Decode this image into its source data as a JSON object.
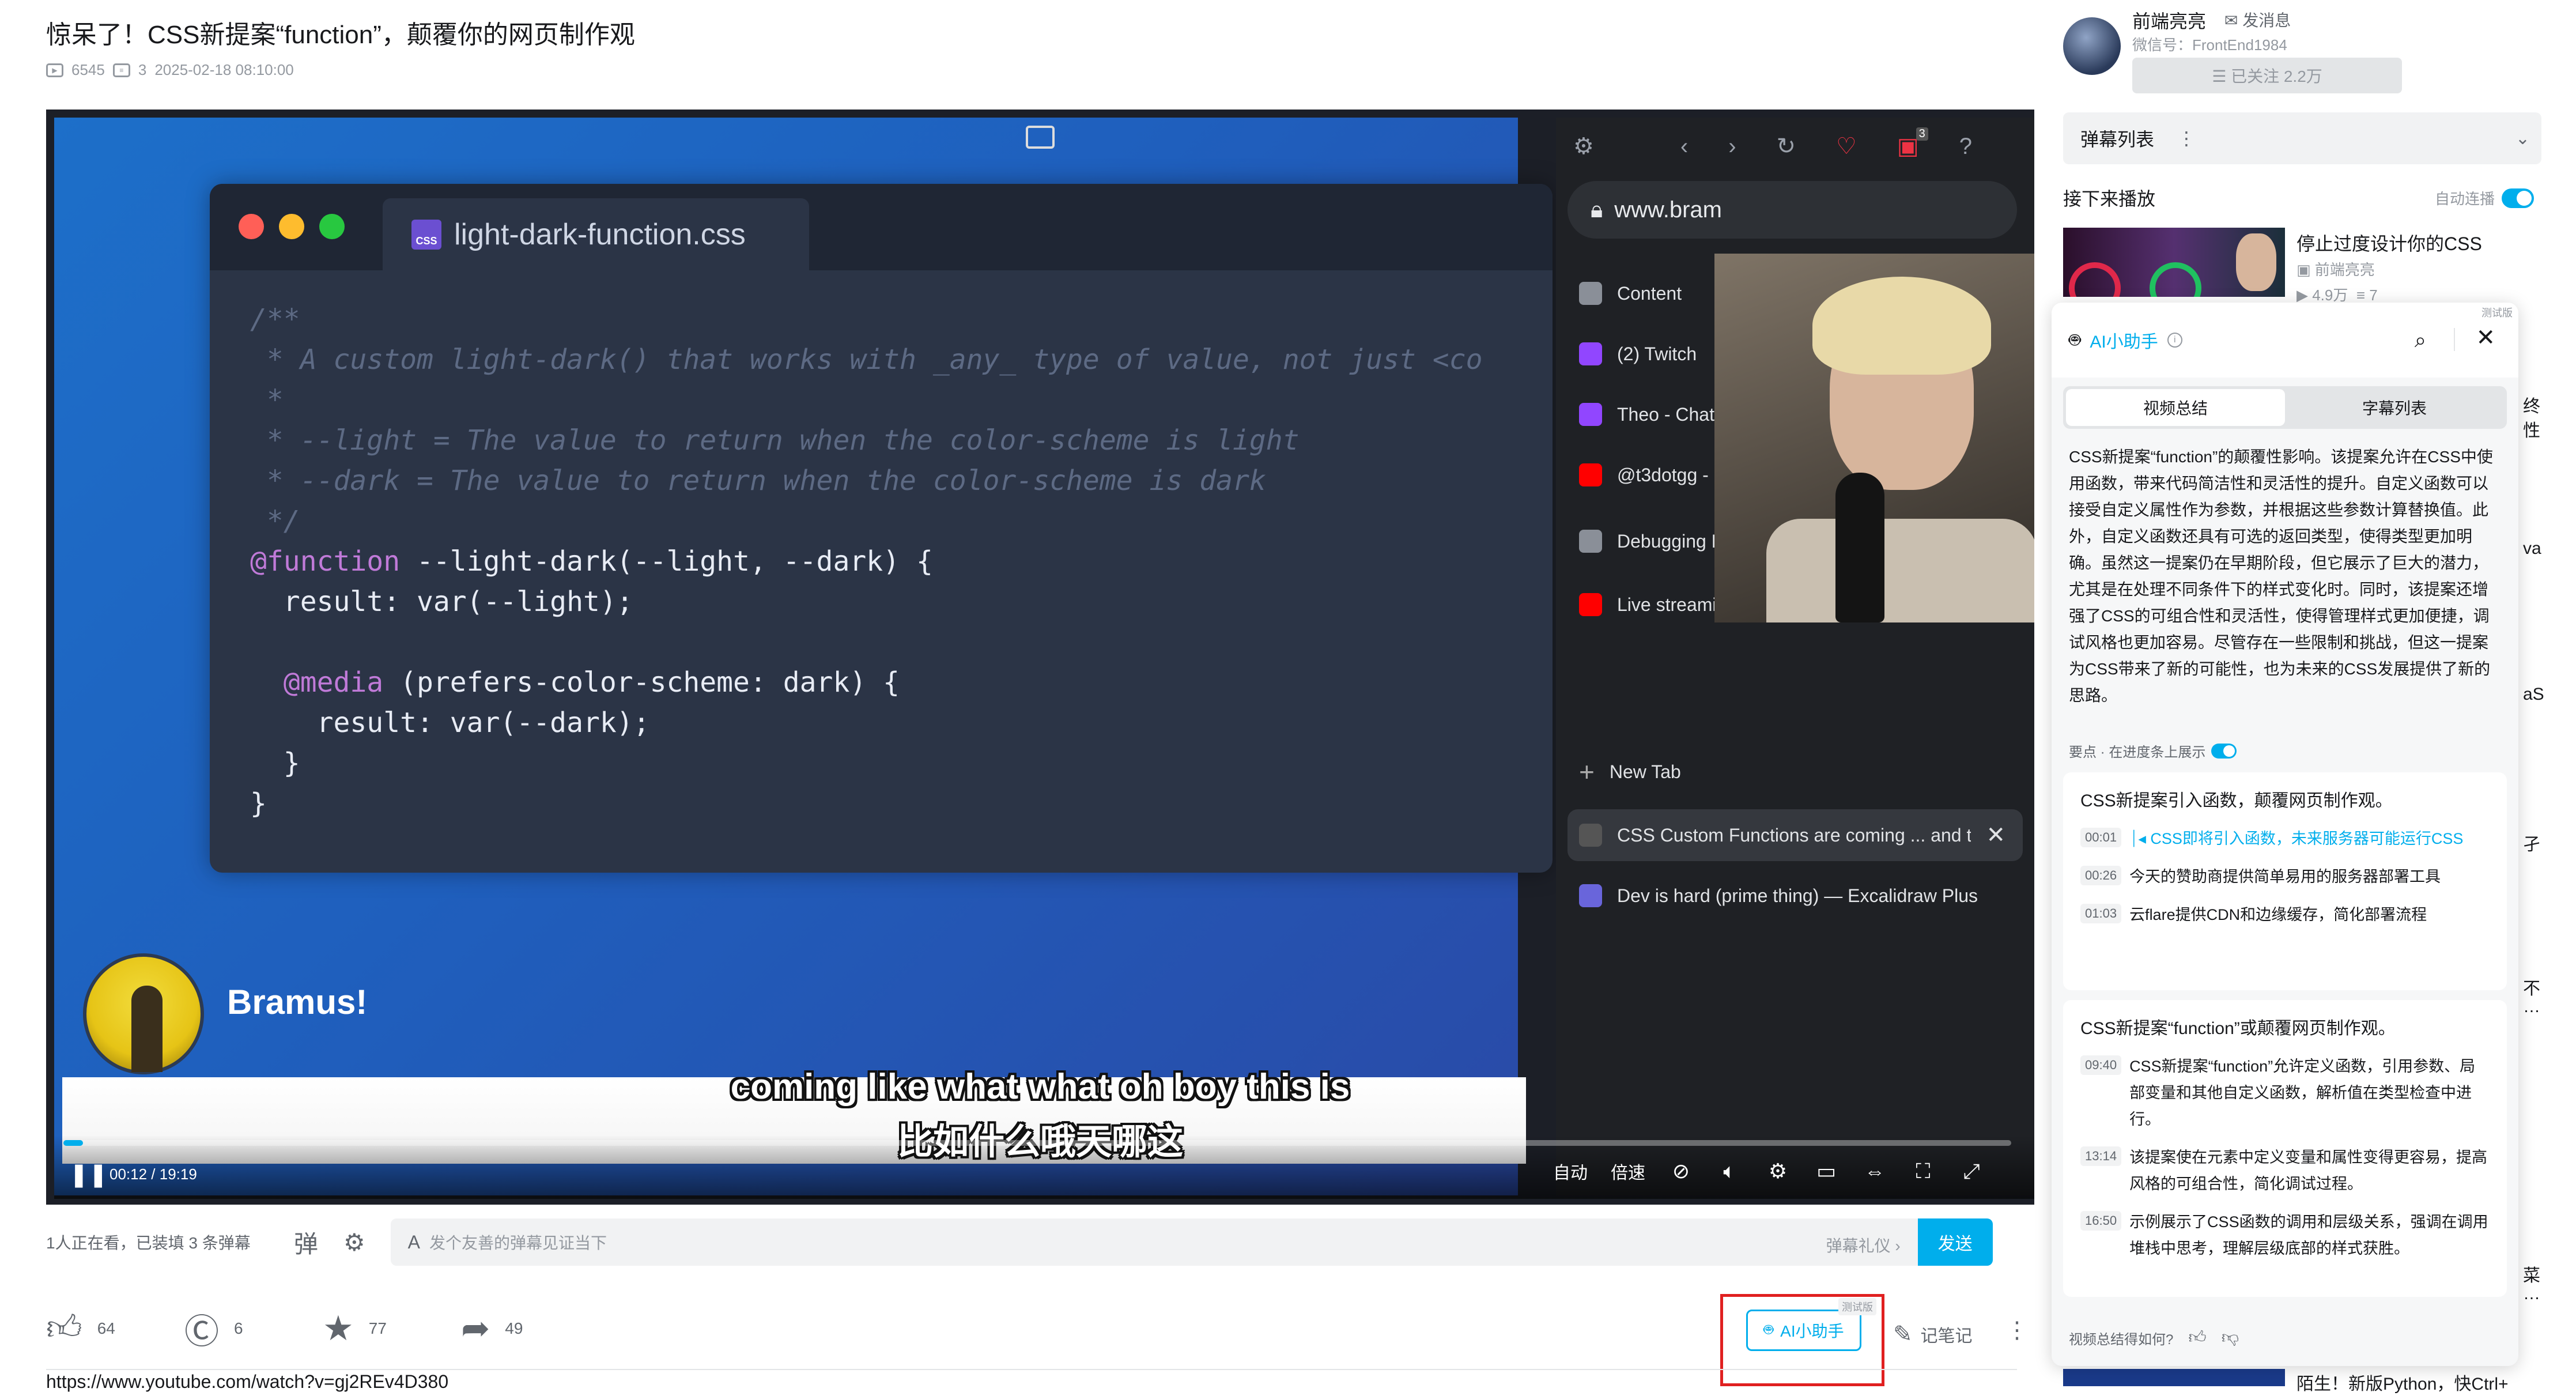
{
  "video": {
    "title": "惊呆了！CSS新提案“function”，颠覆你的网页制作观",
    "views": "6545",
    "comments": "3",
    "date": "2025-02-18 08:10:00"
  },
  "player": {
    "code_tab_title": "light-dark-function.css",
    "code_lines": [
      "/**",
      " * A custom light-dark() that works with _any_ type of value, not just <co",
      " *",
      " * --light = The value to return when the color-scheme is light",
      " * --dark = The value to return when the color-scheme is dark",
      " */",
      "@function --light-dark(--light, --dark) {",
      "  result: var(--light);",
      "",
      "  @media (prefers-color-scheme: dark) {",
      "    result: var(--dark);",
      "  }",
      "}"
    ],
    "speaker_name": "Bramus!",
    "browser_url": "www.bram",
    "browser_tabs": [
      {
        "label": "Content",
        "color": "#8a8f98"
      },
      {
        "label": "(2) Twitch",
        "color": "#9146ff"
      },
      {
        "label": "Theo - Chat",
        "color": "#9146ff"
      },
      {
        "label": "@t3dotgg -",
        "color": "#ff0000"
      },
      {
        "label": "Debugging PostHog Error with Illegal String Ty",
        "color": "#8a8f98"
      },
      {
        "label": "Live streaming - YouTube Studio",
        "color": "#ff0000"
      }
    ],
    "new_tab": "New Tab",
    "active_tab": "CSS Custom Functions are coming ... and t",
    "last_tab": "Dev is hard (prime thing) — Excalidraw Plus",
    "tab_badge": "3",
    "subtitle_en": "coming like what what oh boy this is",
    "subtitle_zh": "比如什么哦天哪这",
    "time_current": "00:12",
    "time_total": "19:19",
    "progress": 0.01,
    "ctrl_auto": "自动",
    "ctrl_speed": "倍速"
  },
  "danmaku": {
    "viewers": "1人正在看，已装填 3 条弹幕",
    "placeholder": "发个友善的弹幕见证当下",
    "gift": "弹幕礼仪 ›",
    "send": "发送"
  },
  "toolbar": {
    "like": "64",
    "coin": "6",
    "fav": "77",
    "share": "49",
    "ai_label": "AI小助手",
    "ai_tag": "测试版",
    "note": "记笔记"
  },
  "source_url": "https://www.youtube.com/watch?v=gj2REv4D380",
  "uploader": {
    "name": "前端亮亮",
    "send_msg": "发消息",
    "wechat": "微信号：FrontEnd1984",
    "follow": "☰ 已关注 2.2万"
  },
  "sidebar": {
    "danmaku_list": "弹幕列表",
    "next_play": "接下来播放",
    "autoplay": "自动连播",
    "rec_title": "停止过度设计你的CSS",
    "rec_up": "前端亮亮",
    "rec_views": "4.9万",
    "rec_comments": "7",
    "peek_texts": [
      "终",
      "性",
      "va",
      "aS",
      "孑",
      "不",
      "…",
      "菜",
      "…"
    ],
    "bottom_title": "陌生！新版Python，快Ctrl+"
  },
  "ai_panel": {
    "tag": "测试版",
    "title": "AI小助手",
    "tab_summary": "视频总结",
    "tab_subtitles": "字幕列表",
    "summary": "CSS新提案“function”的颠覆性影响。该提案允许在CSS中使用函数，带来代码简洁性和灵活性的提升。自定义函数可以接受自定义属性作为参数，并根据这些参数计算替换值。此外，自定义函数还具有可选的返回类型，使得类型更加明确。虽然这一提案仍在早期阶段，但它展示了巨大的潜力，尤其是在处理不同条件下的样式变化时。同时，该提案还增强了CSS的可组合性和灵活性，使得管理样式更加便捷，调试风格也更加容易。尽管存在一些限制和挑战，但这一提案为CSS带来了新的可能性，也为未来的CSS发展提供了新的思路。",
    "keypoints_label": "要点 · 在进度条上展示",
    "sections": [
      {
        "heading": "CSS新提案引入函数，颠覆网页制作观。",
        "points": [
          {
            "time": "00:01",
            "text": "CSS即将引入函数，未来服务器可能运行CSS"
          },
          {
            "time": "00:26",
            "text": "今天的赞助商提供简单易用的服务器部署工具"
          },
          {
            "time": "01:03",
            "text": "云flare提供CDN和边缘缓存，简化部署流程"
          }
        ]
      },
      {
        "heading": "CSS新提案“function”或颠覆网页制作观。",
        "points": [
          {
            "time": "09:40",
            "text": "CSS新提案“function”允许定义函数，引用参数、局部变量和其他自定义函数，解析值在类型检查中进行。"
          },
          {
            "time": "13:14",
            "text": "该提案使在元素中定义变量和属性变得更容易，提高风格的可组合性，简化调试过程。"
          },
          {
            "time": "16:50",
            "text": "示例展示了CSS函数的调用和层级关系，强调在调用堆栈中思考，理解层级底部的样式获胜。"
          }
        ]
      }
    ],
    "feedback": "视频总结得如何?"
  }
}
